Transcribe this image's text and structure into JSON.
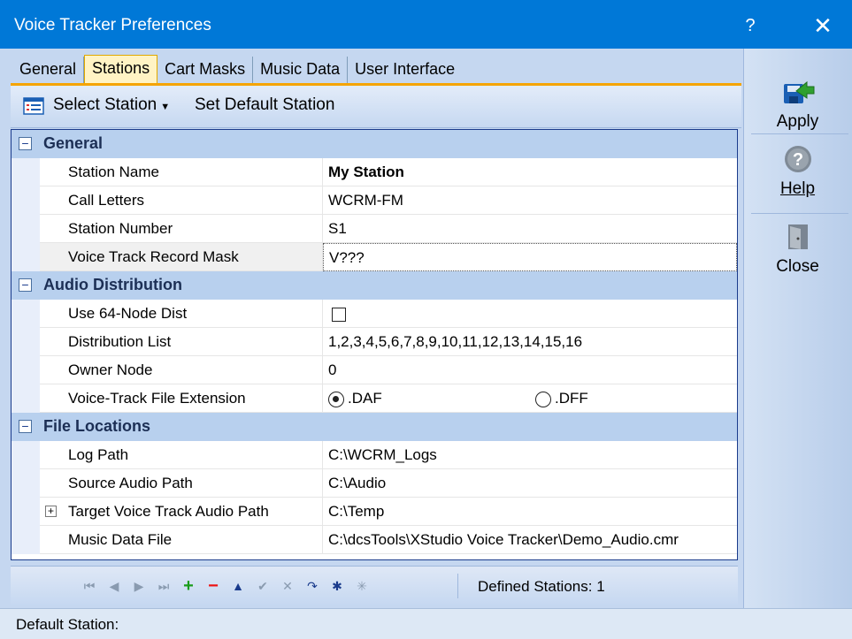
{
  "window": {
    "title": "Voice Tracker Preferences",
    "help_label": "?",
    "close_label": "✕"
  },
  "tabs": [
    {
      "label": "General",
      "active": false
    },
    {
      "label": "Stations",
      "active": true
    },
    {
      "label": "Cart Masks",
      "active": false
    },
    {
      "label": "Music Data",
      "active": false
    },
    {
      "label": "User Interface",
      "active": false
    }
  ],
  "toolbar": {
    "select_station": "Select Station",
    "set_default": "Set Default Station"
  },
  "categories": {
    "general": {
      "label": "General",
      "toggle": "−",
      "rows": [
        {
          "name": "Station Name",
          "value": "My Station"
        },
        {
          "name": "Call Letters",
          "value": "WCRM-FM"
        },
        {
          "name": "Station Number",
          "value": "S1"
        },
        {
          "name": "Voice Track Record Mask",
          "value": "V???"
        }
      ]
    },
    "audio": {
      "label": "Audio Distribution",
      "toggle": "−",
      "rows": [
        {
          "name": "Use 64-Node Dist",
          "value": ""
        },
        {
          "name": "Distribution List",
          "value": "1,2,3,4,5,6,7,8,9,10,11,12,13,14,15,16"
        },
        {
          "name": "Owner Node",
          "value": "0"
        },
        {
          "name": "Voice-Track File Extension",
          "options": [
            ".DAF",
            ".DFF"
          ],
          "selected": ".DAF"
        }
      ]
    },
    "files": {
      "label": "File Locations",
      "toggle": "−",
      "rows": [
        {
          "name": "Log Path",
          "value": "C:\\WCRM_Logs"
        },
        {
          "name": "Source Audio Path",
          "value": "C:\\Audio"
        },
        {
          "name": "Target Voice Track Audio Path",
          "value": "C:\\Temp",
          "expander": "+"
        },
        {
          "name": "Music Data File",
          "value": "C:\\dcsTools\\XStudio Voice Tracker\\Demo_Audio.cmr"
        }
      ]
    }
  },
  "navigator": {
    "buttons": [
      "⏮",
      "◀",
      "▶",
      "⏭",
      "+",
      "−",
      "▲",
      "✔",
      "✕",
      "↷",
      "✱",
      "✳"
    ],
    "defined_stations": "Defined Stations: 1"
  },
  "status": {
    "text": "Default Station:"
  },
  "side_buttons": {
    "apply": "Apply",
    "help": "Help",
    "close": "Close"
  },
  "colors": {
    "titlebar": "#0078d7",
    "tab_active": "#fff3c4",
    "category_band": "#b8d0ee",
    "grid_border": "#1a3b8c"
  }
}
